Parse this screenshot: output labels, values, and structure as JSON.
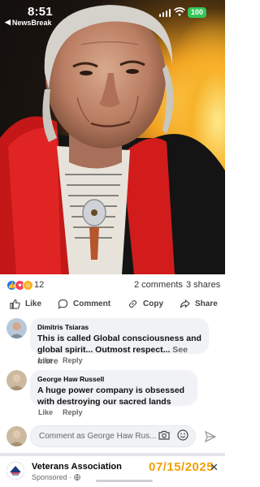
{
  "status_bar": {
    "time": "8:51",
    "back_app": "NewsBreak",
    "battery": "100"
  },
  "photo": {
    "icon": "portrait-photo"
  },
  "reactions": {
    "count": "12",
    "comments": "2 comments",
    "shares": "3 shares"
  },
  "actions": {
    "like": "Like",
    "comment": "Comment",
    "copy": "Copy",
    "share": "Share"
  },
  "comments": [
    {
      "name": "Dimitris Tsiaras",
      "text": "This is called Global consciousness and global spirit... Outmost respect...",
      "more": "See more",
      "like": "Like",
      "reply": "Reply"
    },
    {
      "name": "George Haw Russell",
      "text": "A huge power company is obsessed with destroying our sacred lands",
      "like": "Like",
      "reply": "Reply"
    }
  ],
  "compose": {
    "placeholder": "Comment as George Haw Rus..."
  },
  "next_post": {
    "name": "Veterans Association",
    "sponsored": "Sponsored · ",
    "date_overlay": "07/15/2025"
  },
  "colors": {
    "accent": "#1877f2",
    "date_overlay": "#f2a007",
    "battery": "#34c759"
  }
}
